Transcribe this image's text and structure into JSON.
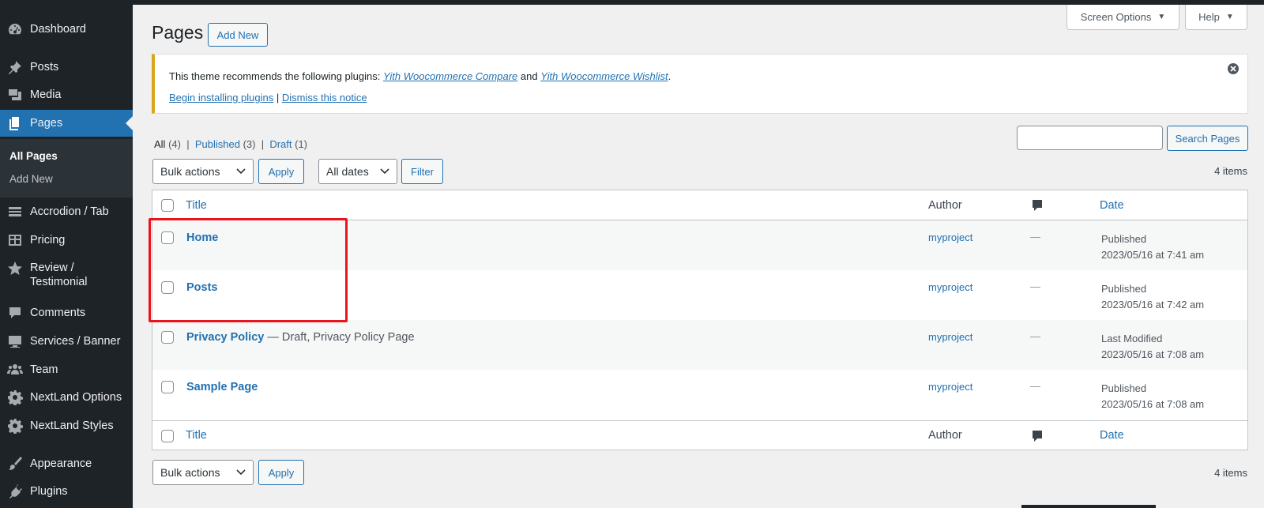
{
  "sidebar": {
    "items": [
      {
        "label": "Dashboard",
        "icon": "dashboard-icon"
      },
      {
        "label": "Posts",
        "icon": "pin-icon"
      },
      {
        "label": "Media",
        "icon": "media-icon"
      },
      {
        "label": "Pages",
        "icon": "pages-icon"
      },
      {
        "label": "Accrodion / Tab",
        "icon": "accordion-icon"
      },
      {
        "label": "Pricing",
        "icon": "pricing-icon"
      },
      {
        "label": "Review /",
        "label2": "Testimonial",
        "icon": "star-icon"
      },
      {
        "label": "Comments",
        "icon": "comment-icon"
      },
      {
        "label": "Services / Banner",
        "icon": "services-icon"
      },
      {
        "label": "Team",
        "icon": "team-icon"
      },
      {
        "label": "NextLand Options",
        "icon": "gear-icon"
      },
      {
        "label": "NextLand Styles",
        "icon": "gear-icon"
      },
      {
        "label": "Appearance",
        "icon": "brush-icon"
      },
      {
        "label": "Plugins",
        "icon": "plugin-icon"
      }
    ],
    "submenu": [
      "All Pages",
      "Add New"
    ]
  },
  "header": {
    "title": "Pages",
    "add_new": "Add New",
    "screen_options": "Screen Options",
    "help": "Help"
  },
  "notice": {
    "text_before": "This theme recommends the following plugins:",
    "plugin1": "Yith Woocommerce Compare",
    "and": "and",
    "plugin2": "Yith Woocommerce Wishlist",
    "period": ".",
    "begin": "Begin installing plugins",
    "sep": "|",
    "dismiss": "Dismiss this notice"
  },
  "filters": {
    "all": "All",
    "all_count": "(4)",
    "published": "Published",
    "published_count": "(3)",
    "draft": "Draft",
    "draft_count": "(1)",
    "sep": "|"
  },
  "toolbar": {
    "bulk_actions": "Bulk actions",
    "apply": "Apply",
    "all_dates": "All dates",
    "filter": "Filter",
    "search_button": "Search Pages",
    "items_count": "4 items"
  },
  "table": {
    "headers": {
      "title": "Title",
      "author": "Author",
      "date": "Date"
    },
    "rows": [
      {
        "title": "Home",
        "state": "",
        "author": "myproject",
        "comments": "—",
        "status": "Published",
        "datetime": "2023/05/16 at 7:41 am"
      },
      {
        "title": "Posts",
        "state": "",
        "author": "myproject",
        "comments": "—",
        "status": "Published",
        "datetime": "2023/05/16 at 7:42 am"
      },
      {
        "title": "Privacy Policy",
        "state": " — Draft, Privacy Policy Page",
        "author": "myproject",
        "comments": "—",
        "status": "Last Modified",
        "datetime": "2023/05/16 at 7:08 am"
      },
      {
        "title": "Sample Page",
        "state": "",
        "author": "myproject",
        "comments": "—",
        "status": "Published",
        "datetime": "2023/05/16 at 7:08 am"
      }
    ]
  },
  "colors": {
    "accent": "#2271b1",
    "sidebar": "#1d2327",
    "highlight": "#e8151d",
    "notice_warning": "#dba617"
  }
}
